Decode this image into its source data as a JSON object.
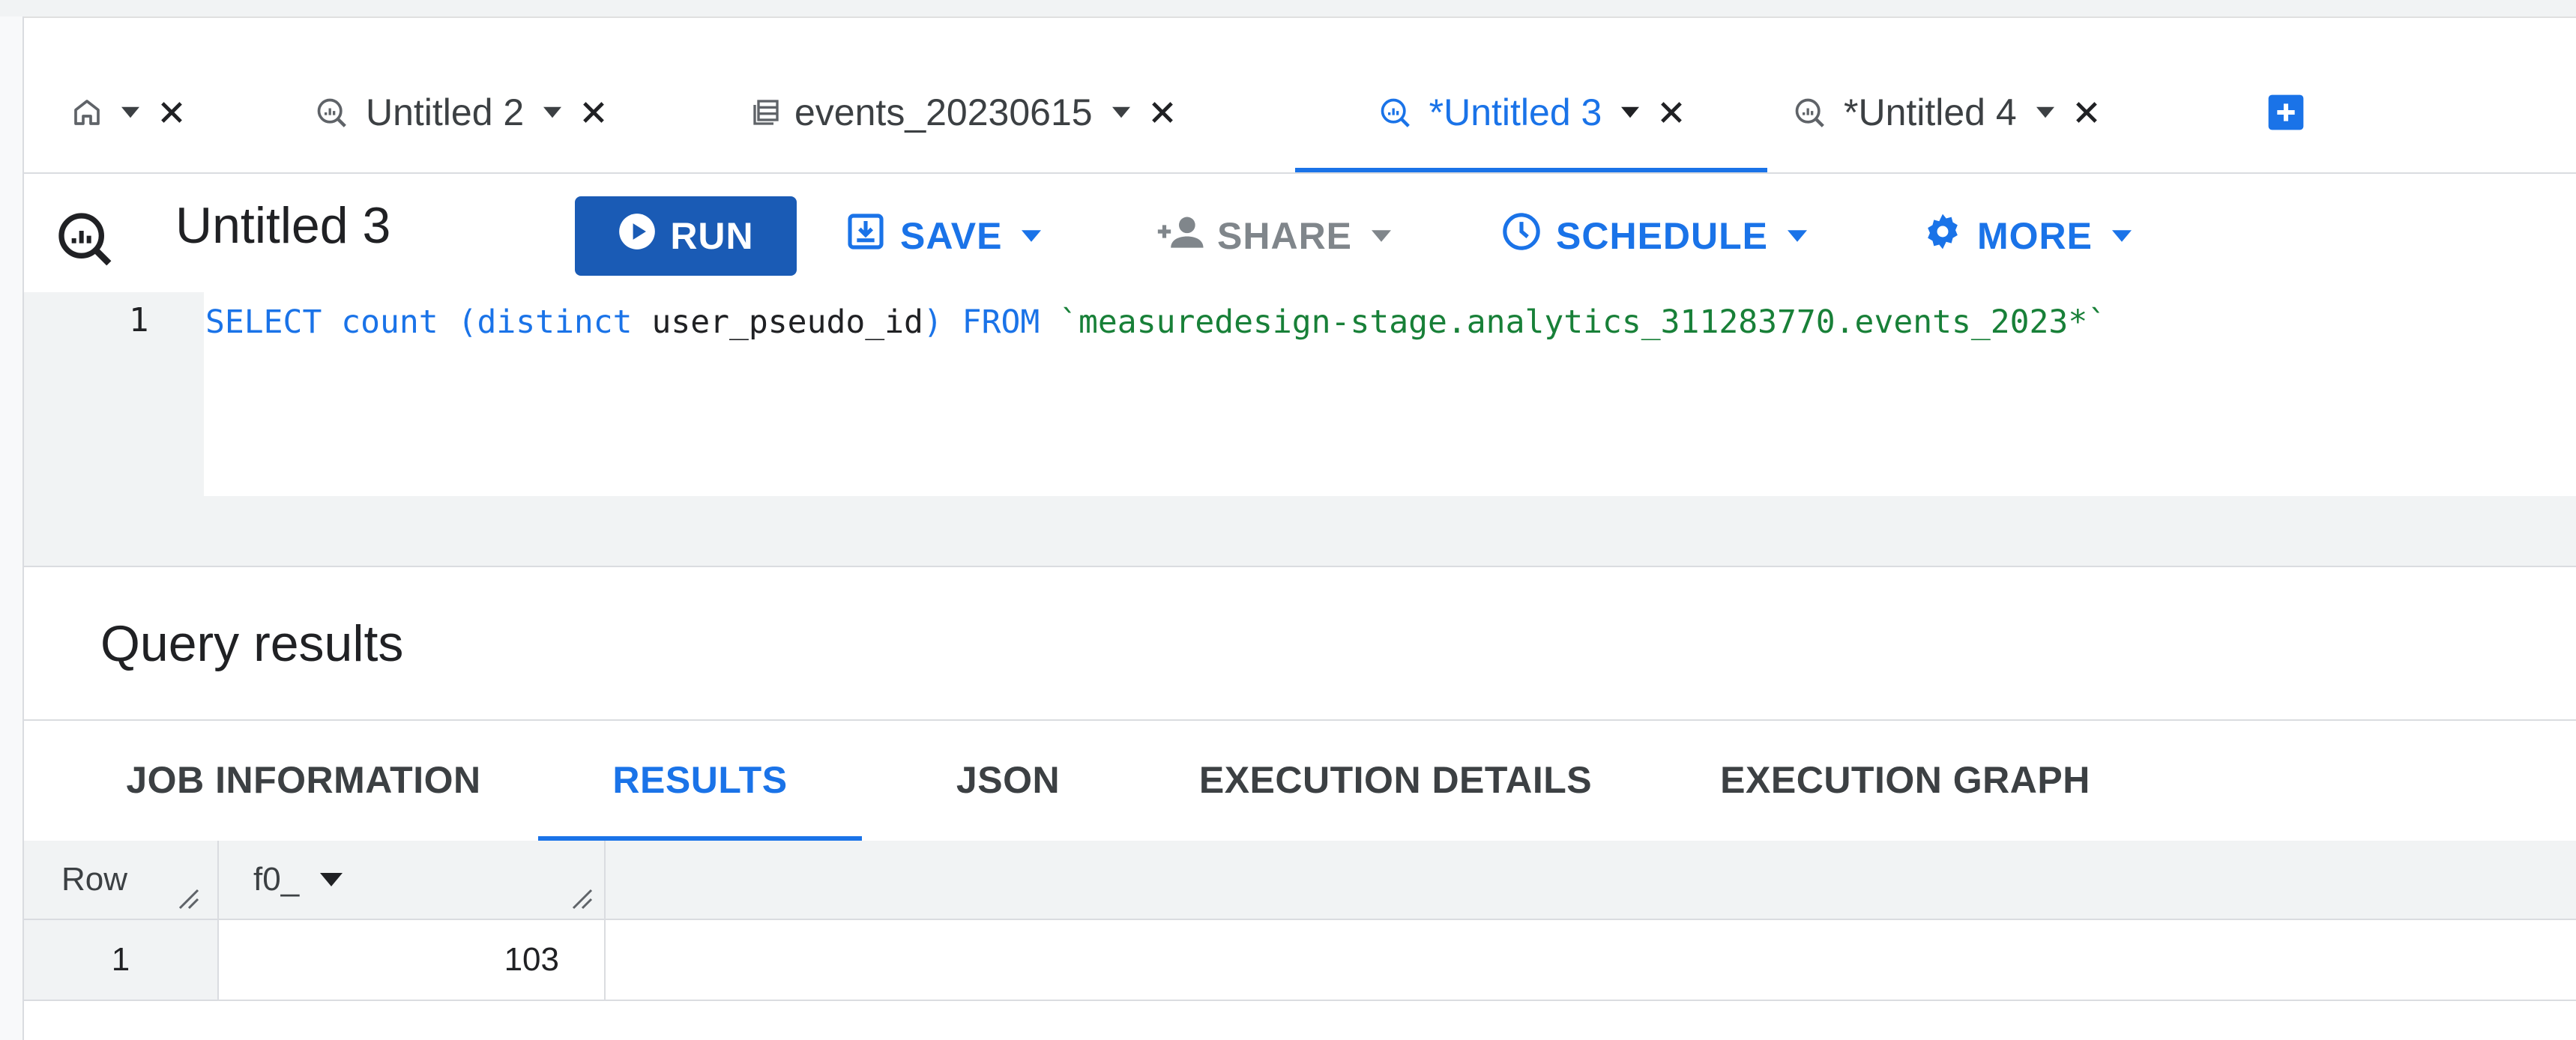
{
  "colors": {
    "accent": "#1a73e8",
    "run_button": "#1a5bb5",
    "string": "#188038",
    "disabled": "#80868b"
  },
  "tabs": [
    {
      "label": "",
      "icon": "home-icon",
      "active": false
    },
    {
      "label": "Untitled 2",
      "icon": "query-icon",
      "active": false
    },
    {
      "label": "events_20230615",
      "icon": "table-icon",
      "active": false
    },
    {
      "label": "*Untitled 3",
      "icon": "query-icon",
      "active": true
    },
    {
      "label": "*Untitled 4",
      "icon": "query-icon",
      "active": false
    }
  ],
  "add_tab_icon": "add-tab-icon",
  "toolbar": {
    "query_title": "Untitled 3",
    "run_label": "RUN",
    "save_label": "SAVE",
    "share_label": "SHARE",
    "schedule_label": "SCHEDULE",
    "more_label": "MORE"
  },
  "editor": {
    "line_number": "1",
    "tokens": {
      "select": "SELECT",
      "count": "count",
      "paren_open": " (",
      "distinct": "distinct",
      "column": " user_pseudo_id",
      "paren_close": ")",
      "from": " FROM",
      "table": " `measuredesign-stage.analytics_311283770.events_2023*`"
    }
  },
  "results": {
    "title": "Query results",
    "tabs": [
      "JOB INFORMATION",
      "RESULTS",
      "JSON",
      "EXECUTION DETAILS",
      "EXECUTION GRAPH"
    ],
    "active_tab": "RESULTS",
    "columns": [
      "Row",
      "f0_"
    ],
    "rows": [
      {
        "row": "1",
        "f0_": "103"
      }
    ]
  }
}
